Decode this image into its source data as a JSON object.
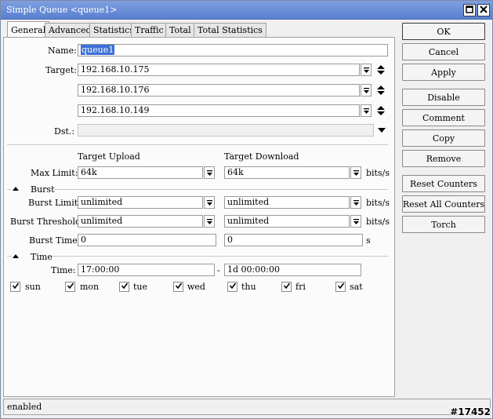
{
  "window": {
    "title": "Simple Queue <queue1>",
    "maximize_icon": "maximize-icon",
    "close_icon": "close-icon"
  },
  "tabs": [
    {
      "label": "General",
      "active": true
    },
    {
      "label": "Advanced"
    },
    {
      "label": "Statistics"
    },
    {
      "label": "Traffic"
    },
    {
      "label": "Total"
    },
    {
      "label": "Total Statistics"
    }
  ],
  "general": {
    "name_label": "Name:",
    "name_value": "queue1",
    "target_label": "Target:",
    "targets": [
      "192.168.10.175",
      "192.168.10.176",
      "192.168.10.149"
    ],
    "dst_label": "Dst.:",
    "dst_value": "",
    "col_upload": "Target Upload",
    "col_download": "Target Download",
    "max_limit_label": "Max Limit:",
    "max_limit_upload": "64k",
    "max_limit_download": "64k",
    "unit_bits": "bits/s"
  },
  "burst": {
    "section_label": "Burst",
    "limit_label": "Burst Limit:",
    "limit_upload": "unlimited",
    "limit_download": "unlimited",
    "threshold_label": "Burst Threshold:",
    "threshold_upload": "unlimited",
    "threshold_download": "unlimited",
    "time_label": "Burst Time:",
    "time_upload": "0",
    "time_download": "0",
    "unit_s": "s"
  },
  "time": {
    "section_label": "Time",
    "time_label": "Time:",
    "start": "17:00:00",
    "dash": "-",
    "end": "1d 00:00:00",
    "days": [
      {
        "label": "sun",
        "checked": true
      },
      {
        "label": "mon",
        "checked": true
      },
      {
        "label": "tue",
        "checked": true
      },
      {
        "label": "wed",
        "checked": true
      },
      {
        "label": "thu",
        "checked": true
      },
      {
        "label": "fri",
        "checked": true
      },
      {
        "label": "sat",
        "checked": true
      }
    ]
  },
  "buttons": {
    "ok": "OK",
    "cancel": "Cancel",
    "apply": "Apply",
    "disable": "Disable",
    "comment": "Comment",
    "copy": "Copy",
    "remove": "Remove",
    "reset_counters": "Reset Counters",
    "reset_all_counters": "Reset All Counters",
    "torch": "Torch"
  },
  "status": {
    "text": "enabled"
  },
  "watermark": "#17452",
  "colors": {
    "titlebar": "#5a7fd0",
    "selection": "#3c6fd8"
  }
}
